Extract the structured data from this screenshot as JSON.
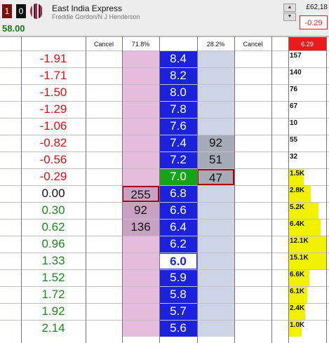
{
  "header": {
    "box1": "1",
    "box2": "0",
    "runner_name": "East India Express",
    "runner_sub": "Freddie Gordon/N J Henderson",
    "price": "58.00",
    "amount": "£62,18",
    "pl": "-0.29"
  },
  "columns": {
    "cancel_left": "Cancel",
    "back_pct": "71.8%",
    "lay_pct": "28.2%",
    "cancel_right": "Cancel",
    "ltp": "6.29"
  },
  "ladder": [
    {
      "pl": "-1.91",
      "pl_color": "#e01010",
      "back": "",
      "odds": "8.4",
      "lay": "",
      "vol": "157"
    },
    {
      "pl": "-1.71",
      "pl_color": "#e01010",
      "back": "",
      "odds": "8.2",
      "lay": "",
      "vol": "140"
    },
    {
      "pl": "-1.50",
      "pl_color": "#e01010",
      "back": "",
      "odds": "8.0",
      "lay": "",
      "vol": "76"
    },
    {
      "pl": "-1.29",
      "pl_color": "#e01010",
      "back": "",
      "odds": "7.8",
      "lay": "",
      "vol": "67"
    },
    {
      "pl": "-1.06",
      "pl_color": "#e01010",
      "back": "",
      "odds": "7.6",
      "lay": "",
      "vol": "10"
    },
    {
      "pl": "-0.82",
      "pl_color": "#e01010",
      "back": "",
      "odds": "7.4",
      "lay": "92",
      "vol": "55"
    },
    {
      "pl": "-0.56",
      "pl_color": "#e01010",
      "back": "",
      "odds": "7.2",
      "lay": "51",
      "vol": "32"
    },
    {
      "pl": "-0.29",
      "pl_color": "#e01010",
      "back": "",
      "odds": "7.0",
      "lay": "47",
      "vol": "1.5K"
    },
    {
      "pl": "0.00",
      "pl_color": "#111111",
      "back": "255",
      "odds": "6.8",
      "lay": "",
      "vol": "2.8K"
    },
    {
      "pl": "0.30",
      "pl_color": "#1a8a1a",
      "back": "92",
      "odds": "6.6",
      "lay": "",
      "vol": "5.2K"
    },
    {
      "pl": "0.62",
      "pl_color": "#1a8a1a",
      "back": "136",
      "odds": "6.4",
      "lay": "",
      "vol": "6.4K"
    },
    {
      "pl": "0.96",
      "pl_color": "#1a8a1a",
      "back": "",
      "odds": "6.2",
      "lay": "",
      "vol": "12.1K"
    },
    {
      "pl": "1.33",
      "pl_color": "#1a8a1a",
      "back": "",
      "odds": "6.0",
      "lay": "",
      "vol": "15.1K"
    },
    {
      "pl": "1.52",
      "pl_color": "#1a8a1a",
      "back": "",
      "odds": "5.9",
      "lay": "",
      "vol": "6.6K"
    },
    {
      "pl": "1.72",
      "pl_color": "#1a8a1a",
      "back": "",
      "odds": "5.8",
      "lay": "",
      "vol": "6.1K"
    },
    {
      "pl": "1.92",
      "pl_color": "#1a8a1a",
      "back": "",
      "odds": "5.7",
      "lay": "",
      "vol": "2.4K"
    },
    {
      "pl": "2.14",
      "pl_color": "#1a8a1a",
      "back": "",
      "odds": "5.6",
      "lay": "",
      "vol": "1.0K"
    }
  ],
  "ltp_odds": "6.0",
  "traded_odds": "7.0",
  "volume_levels": [
    0,
    0,
    0,
    0,
    0,
    0,
    0,
    0.4,
    0.6,
    0.8,
    0.85,
    1.0,
    1.0,
    0.55,
    0.5,
    0.45,
    0.35
  ]
}
